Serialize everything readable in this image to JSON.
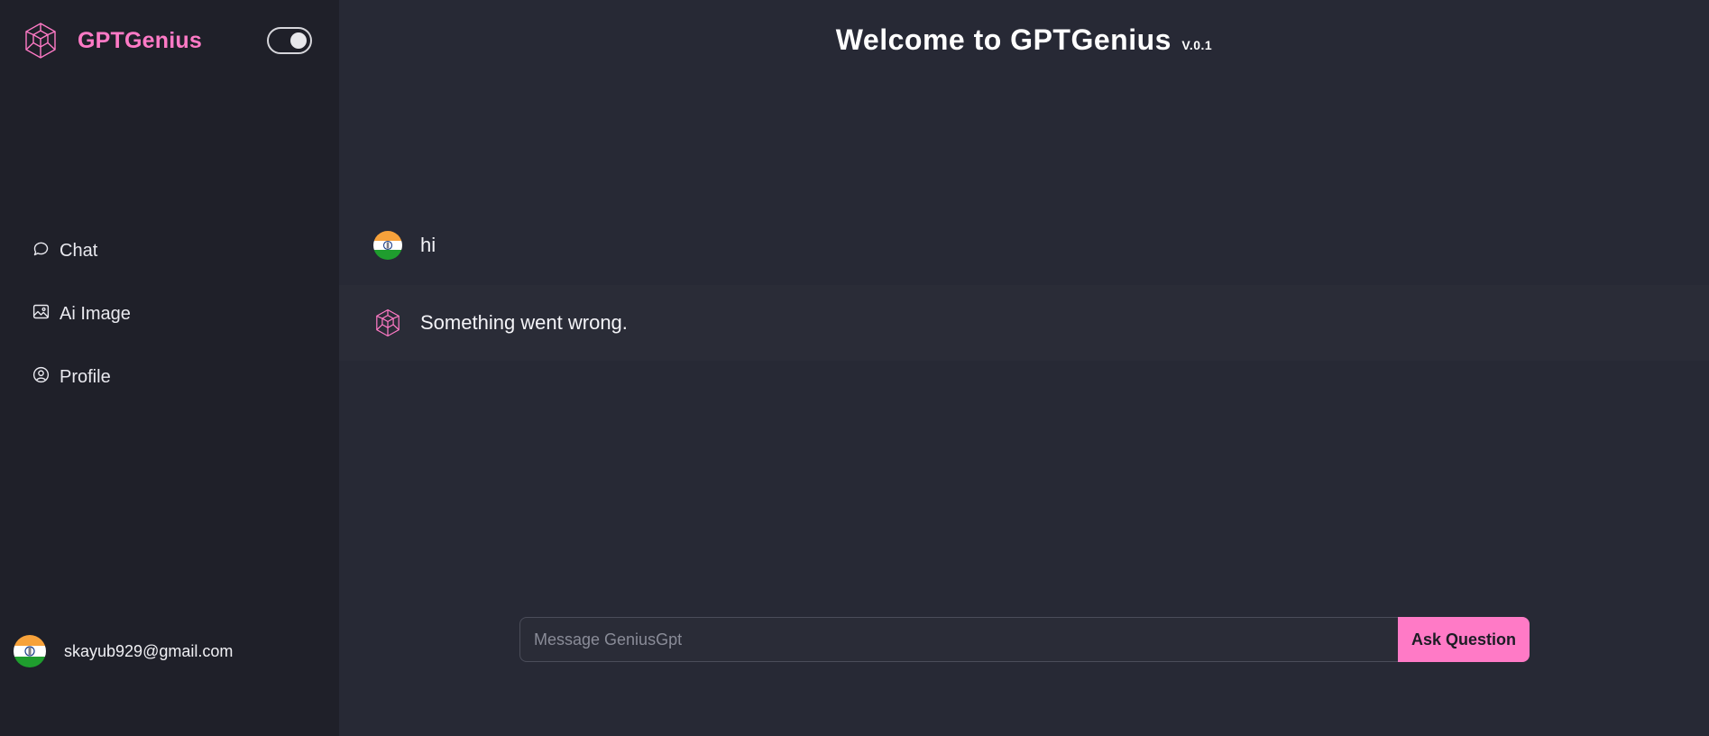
{
  "sidebar": {
    "brand_name": "GPTGenius",
    "brand_logo_icon": "hexagon-cube-logo-icon",
    "theme_toggle_icon": "theme-toggle-switch",
    "nav": [
      {
        "label": "Chat",
        "icon": "chat-bubble-icon"
      },
      {
        "label": "Ai Image",
        "icon": "image-icon"
      },
      {
        "label": "Profile",
        "icon": "user-circle-icon"
      }
    ],
    "user_email": "skayub929@gmail.com"
  },
  "header": {
    "title": "Welcome to GPTGenius",
    "version": "V.0.1"
  },
  "messages": [
    {
      "role": "user",
      "text": "hi"
    },
    {
      "role": "assistant",
      "text": "Something went wrong."
    }
  ],
  "composer": {
    "placeholder": "Message GeniusGpt",
    "value": "",
    "button_label": "Ask Question"
  },
  "colors": {
    "accent": "#ff7ac6",
    "sidebar_bg": "#1f2029",
    "main_bg": "#272935",
    "bot_row_bg": "#2a2c37"
  }
}
